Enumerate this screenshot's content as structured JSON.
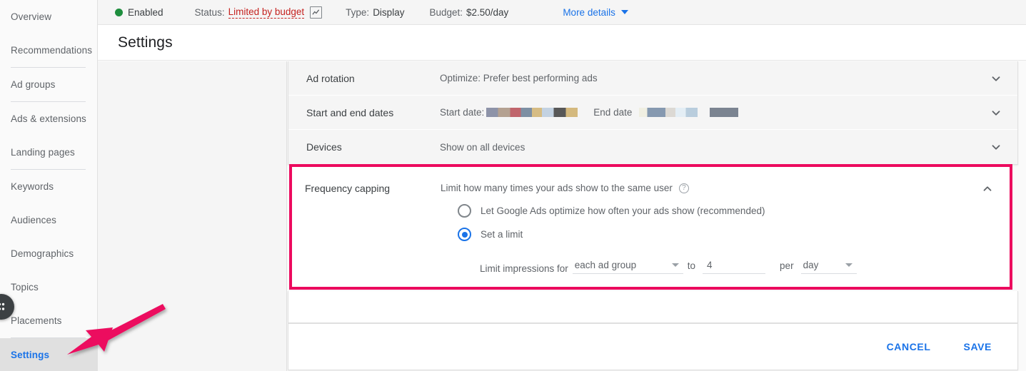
{
  "statusbar": {
    "state": "Enabled",
    "status_label": "Status:",
    "status_value": "Limited by budget",
    "chart_icon": "chart-icon",
    "type_label": "Type:",
    "type_value": "Display",
    "budget_label": "Budget:",
    "budget_value": "$2.50/day",
    "more_details": "More details"
  },
  "page": {
    "title": "Settings"
  },
  "sidebar": {
    "items": [
      {
        "label": "Overview",
        "selected": false
      },
      {
        "label": "Recommendations",
        "selected": false
      },
      {
        "divider": true
      },
      {
        "label": "Ad groups",
        "selected": false
      },
      {
        "divider": true
      },
      {
        "label": "Ads & extensions",
        "selected": false
      },
      {
        "label": "Landing pages",
        "selected": false
      },
      {
        "divider": true
      },
      {
        "label": "Keywords",
        "selected": false
      },
      {
        "label": "Audiences",
        "selected": false
      },
      {
        "label": "Demographics",
        "selected": false
      },
      {
        "label": "Topics",
        "selected": false
      },
      {
        "label": "Placements",
        "selected": false
      },
      {
        "divider": true
      },
      {
        "label": "Settings",
        "selected": true
      }
    ]
  },
  "settings_rows": [
    {
      "label": "Ad rotation",
      "value": "Optimize: Prefer best performing ads",
      "chevron": "chevron-down-icon"
    },
    {
      "label": "Start and end dates",
      "start_label": "Start date:",
      "start_value_redacted": true,
      "end_label": "End date",
      "end_value_redacted": true,
      "chevron": "chevron-down-icon"
    },
    {
      "label": "Devices",
      "value": "Show on all devices",
      "chevron": "chevron-down-icon"
    }
  ],
  "frequency_capping": {
    "title": "Frequency capping",
    "description": "Limit how many times your ads show to the same user",
    "help_icon": "help-icon",
    "collapse_icon": "chevron-up-icon",
    "options": [
      {
        "label": "Let Google Ads optimize how often your ads show (recommended)",
        "selected": false
      },
      {
        "label": "Set a limit",
        "selected": true
      }
    ],
    "limit": {
      "prefix": "Limit impressions for",
      "scope_value": "each ad group",
      "to_label": "to",
      "count_value": "4",
      "per_label": "per",
      "period_value": "day"
    }
  },
  "footer": {
    "cancel_label": "CANCEL",
    "save_label": "SAVE"
  },
  "colors": {
    "highlight": "#ec0a5e",
    "accent_blue": "#1a73e8",
    "enabled_green": "#1e8e3e",
    "warning_red": "#c5221f"
  },
  "annotation": {
    "arrow": "pink-arrow-pointing-to-settings"
  },
  "redacted_blocks": {
    "start": [
      "#8d93a8",
      "#b4a191",
      "#c0656c",
      "#7d8fa3",
      "#d6bc84",
      "#c3d2e2",
      "#585858",
      "#d4b97e"
    ],
    "end": [
      "#f0efe2",
      "#8699b0",
      "#dcd9d4",
      "#e4eef5",
      "#b9cddd",
      "#7b8491"
    ]
  }
}
